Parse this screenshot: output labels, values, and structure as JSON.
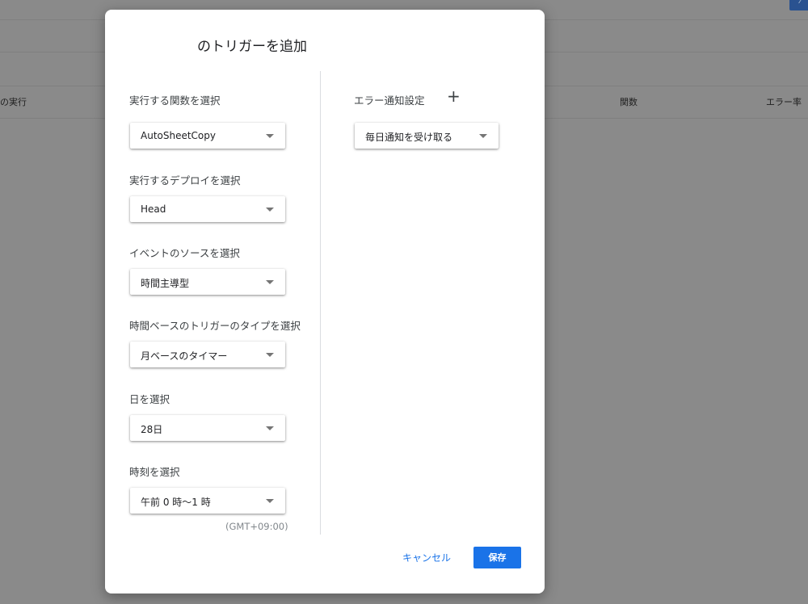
{
  "background": {
    "columns": [
      "の実行",
      "関数",
      "エラー率"
    ]
  },
  "dialog": {
    "title": "のトリガーを追加",
    "fields": [
      {
        "label": "実行する関数を選択",
        "value": "AutoSheetCopy"
      },
      {
        "label": "実行するデプロイを選択",
        "value": "Head"
      },
      {
        "label": "イベントのソースを選択",
        "value": "時間主導型"
      },
      {
        "label": "時間ベースのトリガーのタイプを選択",
        "value": "月ベースのタイマー"
      },
      {
        "label": "日を選択",
        "value": "28日"
      },
      {
        "label": "時刻を選択",
        "value": "午前 0 時～1 時"
      }
    ],
    "timezone": "(GMT+09:00)",
    "error_notification": {
      "label": "エラー通知設定",
      "add_icon": "+",
      "value": "毎日通知を受け取る"
    },
    "buttons": {
      "cancel": "キャンセル",
      "save": "保存"
    }
  },
  "colors": {
    "accent": "#1a73e8",
    "overlay": "#8a8a8a"
  }
}
